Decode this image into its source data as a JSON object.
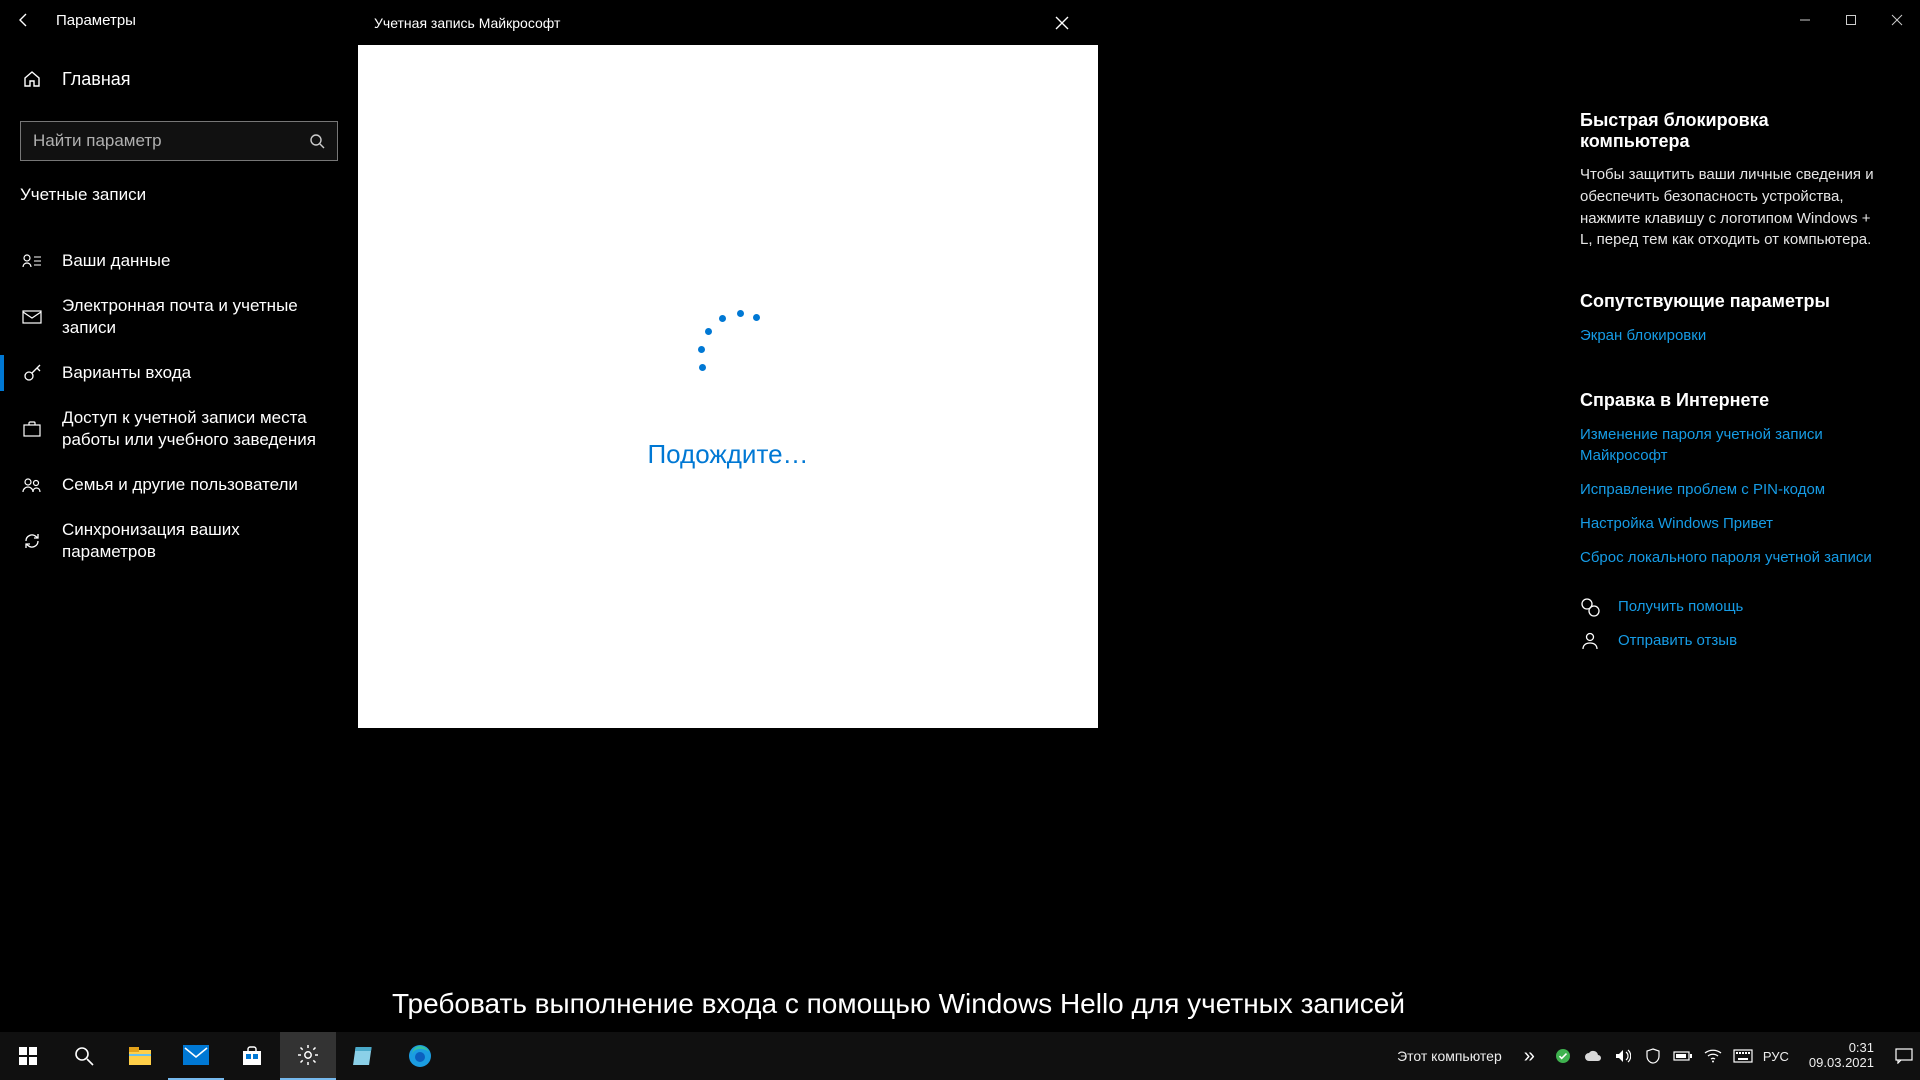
{
  "titlebar": {
    "title": "Параметры"
  },
  "sidebar": {
    "home_label": "Главная",
    "search_placeholder": "Найти параметр",
    "category": "Учетные записи",
    "items": [
      {
        "label": "Ваши данные"
      },
      {
        "label": "Электронная почта и учетные записи"
      },
      {
        "label": "Варианты входа"
      },
      {
        "label": "Доступ к учетной записи места работы или учебного заведения"
      },
      {
        "label": "Семья и другие пользователи"
      },
      {
        "label": "Синхронизация ваших параметров"
      }
    ]
  },
  "main": {
    "partial_heading": "Требовать выполнение входа с помощью Windows Hello для учетных записей"
  },
  "modal": {
    "title": "Учетная запись Майкрософт",
    "wait": "Подождите…"
  },
  "right": {
    "quicklock_heading": "Быстрая блокировка компьютера",
    "quicklock_body": "Чтобы защитить ваши личные сведения и обеспечить безопасность устройства, нажмите клавишу с логотипом Windows + L, перед тем как отходить от компьютера.",
    "related_heading": "Сопутствующие параметры",
    "related_link": "Экран блокировки",
    "help_heading": "Справка в Интернете",
    "help_links": [
      "Изменение пароля учетной записи Майкрософт",
      "Исправление проблем с PIN-кодом",
      "Настройка Windows Привет",
      "Сброс локального пароля учетной записи"
    ],
    "get_help": "Получить помощь",
    "feedback": "Отправить отзыв"
  },
  "taskbar": {
    "this_pc": "Этот компьютер",
    "lang": "РУС",
    "time": "0:31",
    "date": "09.03.2021"
  }
}
